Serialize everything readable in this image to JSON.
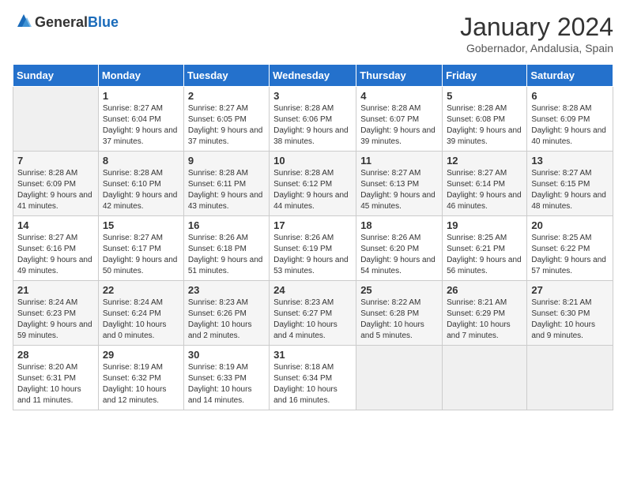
{
  "header": {
    "logo_general": "General",
    "logo_blue": "Blue",
    "month_title": "January 2024",
    "subtitle": "Gobernador, Andalusia, Spain"
  },
  "days_of_week": [
    "Sunday",
    "Monday",
    "Tuesday",
    "Wednesday",
    "Thursday",
    "Friday",
    "Saturday"
  ],
  "weeks": [
    [
      {
        "day": "",
        "info": ""
      },
      {
        "day": "1",
        "info": "Sunrise: 8:27 AM\nSunset: 6:04 PM\nDaylight: 9 hours and 37 minutes."
      },
      {
        "day": "2",
        "info": "Sunrise: 8:27 AM\nSunset: 6:05 PM\nDaylight: 9 hours and 37 minutes."
      },
      {
        "day": "3",
        "info": "Sunrise: 8:28 AM\nSunset: 6:06 PM\nDaylight: 9 hours and 38 minutes."
      },
      {
        "day": "4",
        "info": "Sunrise: 8:28 AM\nSunset: 6:07 PM\nDaylight: 9 hours and 39 minutes."
      },
      {
        "day": "5",
        "info": "Sunrise: 8:28 AM\nSunset: 6:08 PM\nDaylight: 9 hours and 39 minutes."
      },
      {
        "day": "6",
        "info": "Sunrise: 8:28 AM\nSunset: 6:09 PM\nDaylight: 9 hours and 40 minutes."
      }
    ],
    [
      {
        "day": "7",
        "info": "Sunrise: 8:28 AM\nSunset: 6:09 PM\nDaylight: 9 hours and 41 minutes."
      },
      {
        "day": "8",
        "info": "Sunrise: 8:28 AM\nSunset: 6:10 PM\nDaylight: 9 hours and 42 minutes."
      },
      {
        "day": "9",
        "info": "Sunrise: 8:28 AM\nSunset: 6:11 PM\nDaylight: 9 hours and 43 minutes."
      },
      {
        "day": "10",
        "info": "Sunrise: 8:28 AM\nSunset: 6:12 PM\nDaylight: 9 hours and 44 minutes."
      },
      {
        "day": "11",
        "info": "Sunrise: 8:27 AM\nSunset: 6:13 PM\nDaylight: 9 hours and 45 minutes."
      },
      {
        "day": "12",
        "info": "Sunrise: 8:27 AM\nSunset: 6:14 PM\nDaylight: 9 hours and 46 minutes."
      },
      {
        "day": "13",
        "info": "Sunrise: 8:27 AM\nSunset: 6:15 PM\nDaylight: 9 hours and 48 minutes."
      }
    ],
    [
      {
        "day": "14",
        "info": "Sunrise: 8:27 AM\nSunset: 6:16 PM\nDaylight: 9 hours and 49 minutes."
      },
      {
        "day": "15",
        "info": "Sunrise: 8:27 AM\nSunset: 6:17 PM\nDaylight: 9 hours and 50 minutes."
      },
      {
        "day": "16",
        "info": "Sunrise: 8:26 AM\nSunset: 6:18 PM\nDaylight: 9 hours and 51 minutes."
      },
      {
        "day": "17",
        "info": "Sunrise: 8:26 AM\nSunset: 6:19 PM\nDaylight: 9 hours and 53 minutes."
      },
      {
        "day": "18",
        "info": "Sunrise: 8:26 AM\nSunset: 6:20 PM\nDaylight: 9 hours and 54 minutes."
      },
      {
        "day": "19",
        "info": "Sunrise: 8:25 AM\nSunset: 6:21 PM\nDaylight: 9 hours and 56 minutes."
      },
      {
        "day": "20",
        "info": "Sunrise: 8:25 AM\nSunset: 6:22 PM\nDaylight: 9 hours and 57 minutes."
      }
    ],
    [
      {
        "day": "21",
        "info": "Sunrise: 8:24 AM\nSunset: 6:23 PM\nDaylight: 9 hours and 59 minutes."
      },
      {
        "day": "22",
        "info": "Sunrise: 8:24 AM\nSunset: 6:24 PM\nDaylight: 10 hours and 0 minutes."
      },
      {
        "day": "23",
        "info": "Sunrise: 8:23 AM\nSunset: 6:26 PM\nDaylight: 10 hours and 2 minutes."
      },
      {
        "day": "24",
        "info": "Sunrise: 8:23 AM\nSunset: 6:27 PM\nDaylight: 10 hours and 4 minutes."
      },
      {
        "day": "25",
        "info": "Sunrise: 8:22 AM\nSunset: 6:28 PM\nDaylight: 10 hours and 5 minutes."
      },
      {
        "day": "26",
        "info": "Sunrise: 8:21 AM\nSunset: 6:29 PM\nDaylight: 10 hours and 7 minutes."
      },
      {
        "day": "27",
        "info": "Sunrise: 8:21 AM\nSunset: 6:30 PM\nDaylight: 10 hours and 9 minutes."
      }
    ],
    [
      {
        "day": "28",
        "info": "Sunrise: 8:20 AM\nSunset: 6:31 PM\nDaylight: 10 hours and 11 minutes."
      },
      {
        "day": "29",
        "info": "Sunrise: 8:19 AM\nSunset: 6:32 PM\nDaylight: 10 hours and 12 minutes."
      },
      {
        "day": "30",
        "info": "Sunrise: 8:19 AM\nSunset: 6:33 PM\nDaylight: 10 hours and 14 minutes."
      },
      {
        "day": "31",
        "info": "Sunrise: 8:18 AM\nSunset: 6:34 PM\nDaylight: 10 hours and 16 minutes."
      },
      {
        "day": "",
        "info": ""
      },
      {
        "day": "",
        "info": ""
      },
      {
        "day": "",
        "info": ""
      }
    ]
  ]
}
